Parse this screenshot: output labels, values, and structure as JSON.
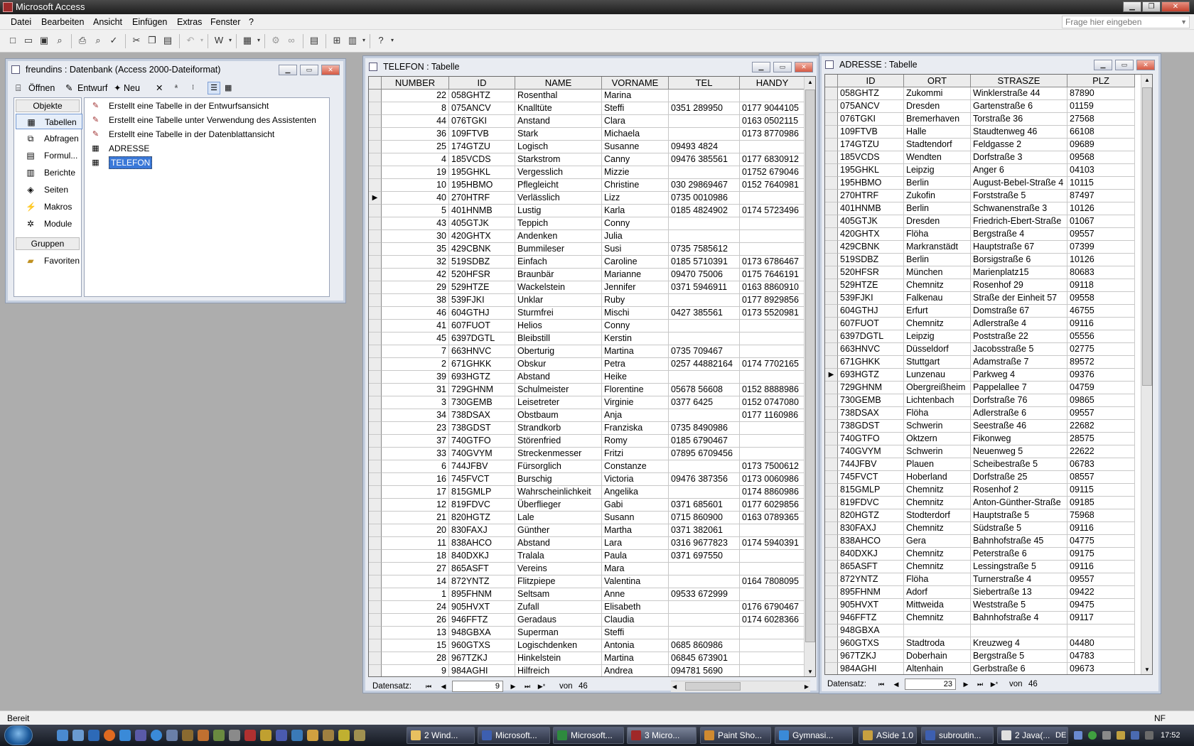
{
  "app": {
    "title": "Microsoft Access"
  },
  "menu": [
    "Datei",
    "Bearbeiten",
    "Ansicht",
    "Einfügen",
    "Extras",
    "Fenster",
    "?"
  ],
  "help_placeholder": "Frage hier eingeben",
  "toolbar_icons": [
    "new-icon",
    "open-icon",
    "save-icon",
    "search-icon",
    "print-icon",
    "print-preview-icon",
    "spellcheck-icon",
    "cut-icon",
    "copy-icon",
    "paste-icon",
    "undo-icon",
    "redo-icon",
    "office-links-icon",
    "analyze-icon",
    "code-icon",
    "properties-icon",
    "relationships-icon",
    "new-object-icon",
    "help-icon"
  ],
  "dbwindow": {
    "title": "freundins : Datenbank (Access 2000-Dateiformat)",
    "toolbar": {
      "open": "Öffnen",
      "design": "Entwurf",
      "new": "Neu"
    },
    "objects_header": "Objekte",
    "objects": [
      {
        "label": "Tabellen",
        "icon": "table-icon",
        "selected": true
      },
      {
        "label": "Abfragen",
        "icon": "query-icon"
      },
      {
        "label": "Formul...",
        "icon": "form-icon"
      },
      {
        "label": "Berichte",
        "icon": "report-icon"
      },
      {
        "label": "Seiten",
        "icon": "page-icon"
      },
      {
        "label": "Makros",
        "icon": "macro-icon"
      },
      {
        "label": "Module",
        "icon": "module-icon"
      }
    ],
    "groups_header": "Gruppen",
    "groups": [
      {
        "label": "Favoriten",
        "icon": "favorites-folder-icon"
      }
    ],
    "items": [
      {
        "label": "Erstellt eine Tabelle in der Entwurfsansicht",
        "icon": "wizard-icon"
      },
      {
        "label": "Erstellt eine Tabelle unter Verwendung des Assistenten",
        "icon": "wizard-icon"
      },
      {
        "label": "Erstellt eine Tabelle in der Datenblattansicht",
        "icon": "wizard-icon"
      },
      {
        "label": "ADRESSE",
        "icon": "table-icon"
      },
      {
        "label": "TELEFON",
        "icon": "table-icon",
        "selected": true
      }
    ]
  },
  "telefon": {
    "title": "TELEFON : Tabelle",
    "columns": [
      "NUMBER",
      "ID",
      "NAME",
      "VORNAME",
      "TEL",
      "HANDY"
    ],
    "current_row": 9,
    "rows": [
      [
        "22",
        "058GHTZ",
        "Rosenthal",
        "Marina",
        "",
        ""
      ],
      [
        "8",
        "075ANCV",
        "Knalltüte",
        "Steffi",
        "0351 289950",
        "0177 9044105"
      ],
      [
        "44",
        "076TGKI",
        "Anstand",
        "Clara",
        "",
        "0163 0502115"
      ],
      [
        "36",
        "109FTVB",
        "Stark",
        "Michaela",
        "",
        "0173 8770986"
      ],
      [
        "25",
        "174GTZU",
        "Logisch",
        "Susanne",
        "09493 4824",
        ""
      ],
      [
        "4",
        "185VCDS",
        "Starkstrom",
        "Canny",
        "09476 385561",
        "0177 6830912"
      ],
      [
        "19",
        "195GHKL",
        "Vergesslich",
        "Mizzie",
        "",
        "01752 679046"
      ],
      [
        "10",
        "195HBMO",
        "Pflegleicht",
        "Christine",
        "030 29869467",
        "0152 7640981"
      ],
      [
        "40",
        "270HTRF",
        "Verlässlich",
        "Lizz",
        "0735 0010986",
        ""
      ],
      [
        "5",
        "401HNMB",
        "Lustig",
        "Karla",
        "0185 4824902",
        "0174 5723496"
      ],
      [
        "43",
        "405GTJK",
        "Teppich",
        "Conny",
        "",
        ""
      ],
      [
        "30",
        "420GHTX",
        "Andenken",
        "Julia",
        "",
        ""
      ],
      [
        "35",
        "429CBNK",
        "Bummileser",
        "Susi",
        "0735 7585612",
        ""
      ],
      [
        "32",
        "519SDBZ",
        "Einfach",
        "Caroline",
        "0185 5710391",
        "0173 6786467"
      ],
      [
        "42",
        "520HFSR",
        "Braunbär",
        "Marianne",
        "09470 75006",
        "0175 7646191"
      ],
      [
        "29",
        "529HTZE",
        "Wackelstein",
        "Jennifer",
        "0371 5946911",
        "0163 8860910"
      ],
      [
        "38",
        "539FJKI",
        "Unklar",
        "Ruby",
        "",
        "0177 8929856"
      ],
      [
        "46",
        "604GTHJ",
        "Sturmfrei",
        "Mischi",
        "0427 385561",
        "0173 5520981"
      ],
      [
        "41",
        "607FUOT",
        "Helios",
        "Conny",
        "",
        ""
      ],
      [
        "45",
        "6397DGTL",
        "Bleibstill",
        "Kerstin",
        "",
        ""
      ],
      [
        "7",
        "663HNVC",
        "Oberturig",
        "Martina",
        "0735 709467",
        ""
      ],
      [
        "2",
        "671GHKK",
        "Obskur",
        "Petra",
        "0257 44882164",
        "0174 7702165"
      ],
      [
        "39",
        "693HGTZ",
        "Abstand",
        "Heike",
        "",
        ""
      ],
      [
        "31",
        "729GHNM",
        "Schulmeister",
        "Florentine",
        "05678 56608",
        "0152 8888986"
      ],
      [
        "3",
        "730GEMB",
        "Leisetreter",
        "Virginie",
        "0377 6425",
        "0152 0747080"
      ],
      [
        "34",
        "738DSAX",
        "Obstbaum",
        "Anja",
        "",
        "0177 1160986"
      ],
      [
        "23",
        "738GDST",
        "Strandkorb",
        "Franziska",
        "0735 8490986",
        ""
      ],
      [
        "37",
        "740GTFO",
        "Störenfried",
        "Romy",
        "0185 6790467",
        ""
      ],
      [
        "33",
        "740GVYM",
        "Streckenmesser",
        "Fritzi",
        "07895 6709456",
        ""
      ],
      [
        "6",
        "744JFBV",
        "Fürsorglich",
        "Constanze",
        "",
        "0173 7500612"
      ],
      [
        "16",
        "745FVCT",
        "Burschig",
        "Victoria",
        "09476 387356",
        "0173 0060986"
      ],
      [
        "17",
        "815GMLP",
        "Wahrscheinlichkeit",
        "Angelika",
        "",
        "0174 8860986"
      ],
      [
        "12",
        "819FDVC",
        "Überflieger",
        "Gabi",
        "0371 685601",
        "0177 6029856"
      ],
      [
        "21",
        "820HGTZ",
        "Lale",
        "Susann",
        "0715 860900",
        "0163 0789365"
      ],
      [
        "20",
        "830FAXJ",
        "Günther",
        "Martha",
        "0371 382061",
        ""
      ],
      [
        "11",
        "838AHCO",
        "Abstand",
        "Lara",
        "0316 9677823",
        "0174 5940391"
      ],
      [
        "18",
        "840DXKJ",
        "Tralala",
        "Paula",
        "0371 697550",
        ""
      ],
      [
        "27",
        "865ASFT",
        "Vereins",
        "Mara",
        "",
        ""
      ],
      [
        "14",
        "872YNTZ",
        "Flitzpiepe",
        "Valentina",
        "",
        "0164 7808095"
      ],
      [
        "1",
        "895FHNM",
        "Seltsam",
        "Anne",
        "09533 672999",
        ""
      ],
      [
        "24",
        "905HVXT",
        "Zufall",
        "Elisabeth",
        "",
        "0176 6790467"
      ],
      [
        "26",
        "946FFTZ",
        "Geradaus",
        "Claudia",
        "",
        "0174 6028366"
      ],
      [
        "13",
        "948GBXA",
        "Superman",
        "Steffi",
        "",
        ""
      ],
      [
        "15",
        "960GTXS",
        "Logischdenken",
        "Antonia",
        "0685 860986",
        ""
      ],
      [
        "28",
        "967TZKJ",
        "Hinkelstein",
        "Martina",
        "06845 673901",
        ""
      ],
      [
        "9",
        "984AGHI",
        "Hilfreich",
        "Andrea",
        "094781 5690",
        ""
      ]
    ],
    "nav": {
      "label": "Datensatz:",
      "current": "9",
      "of": "von",
      "total": "46"
    }
  },
  "adresse": {
    "title": "ADRESSE : Tabelle",
    "columns": [
      "ID",
      "ORT",
      "STRASZE",
      "PLZ"
    ],
    "current_row": 23,
    "rows": [
      [
        "058GHTZ",
        "Zukommi",
        "Winklerstraße 44",
        "87890"
      ],
      [
        "075ANCV",
        "Dresden",
        "Gartenstraße 6",
        "01159"
      ],
      [
        "076TGKI",
        "Bremerhaven",
        "Torstraße 36",
        "27568"
      ],
      [
        "109FTVB",
        "Halle",
        "Staudtenweg 46",
        "66108"
      ],
      [
        "174GTZU",
        "Stadtendorf",
        "Feldgasse 2",
        "09689"
      ],
      [
        "185VCDS",
        "Wendten",
        "Dorfstraße 3",
        "09568"
      ],
      [
        "195GHKL",
        "Leipzig",
        "Anger 6",
        "04103"
      ],
      [
        "195HBMO",
        "Berlin",
        "August-Bebel-Straße 4",
        "10115"
      ],
      [
        "270HTRF",
        "Zukofin",
        "Forststraße 5",
        "87497"
      ],
      [
        "401HNMB",
        "Berlin",
        "Schwanenstraße 3",
        "10126"
      ],
      [
        "405GTJK",
        "Dresden",
        "Friedrich-Ebert-Straße",
        "01067"
      ],
      [
        "420GHTX",
        "Flöha",
        "Bergstraße 4",
        "09557"
      ],
      [
        "429CBNK",
        "Markranstädt",
        "Hauptstraße 67",
        "07399"
      ],
      [
        "519SDBZ",
        "Berlin",
        "Borsigstraße 6",
        "10126"
      ],
      [
        "520HFSR",
        "München",
        "Marienplatz15",
        "80683"
      ],
      [
        "529HTZE",
        "Chemnitz",
        "Rosenhof 29",
        "09118"
      ],
      [
        "539FJKI",
        "Falkenau",
        "Straße der Einheit 57",
        "09558"
      ],
      [
        "604GTHJ",
        "Erfurt",
        "Domstraße 67",
        "46755"
      ],
      [
        "607FUOT",
        "Chemnitz",
        "Adlerstraße 4",
        "09116"
      ],
      [
        "6397DGTL",
        "Leipzig",
        "Poststraße 22",
        "05556"
      ],
      [
        "663HNVC",
        "Düsseldorf",
        "Jacobsstraße 5",
        "02775"
      ],
      [
        "671GHKK",
        "Stuttgart",
        "Adamstraße 7",
        "89572"
      ],
      [
        "693HGTZ",
        "Lunzenau",
        "Parkweg 4",
        "09376"
      ],
      [
        "729GHNM",
        "Obergreißheim",
        "Pappelallee 7",
        "04759"
      ],
      [
        "730GEMB",
        "Lichtenbach",
        "Dorfstraße 76",
        "09865"
      ],
      [
        "738DSAX",
        "Flöha",
        "Adlerstraße 6",
        "09557"
      ],
      [
        "738GDST",
        "Schwerin",
        "Seestraße 46",
        "22682"
      ],
      [
        "740GTFO",
        "Oktzern",
        "Fikonweg",
        "28575"
      ],
      [
        "740GVYM",
        "Schwerin",
        "Neuenweg 5",
        "22622"
      ],
      [
        "744JFBV",
        "Plauen",
        "Scheibestraße 5",
        "06783"
      ],
      [
        "745FVCT",
        "Hoberland",
        "Dorfstraße 25",
        "08557"
      ],
      [
        "815GMLP",
        "Chemnitz",
        "Rosenhof 2",
        "09115"
      ],
      [
        "819FDVC",
        "Chemnitz",
        "Anton-Günther-Straße",
        "09185"
      ],
      [
        "820HGTZ",
        "Stodterdorf",
        "Hauptstraße 5",
        "75968"
      ],
      [
        "830FAXJ",
        "Chemnitz",
        "Südstraße 5",
        "09116"
      ],
      [
        "838AHCO",
        "Gera",
        "Bahnhofstraße 45",
        "04775"
      ],
      [
        "840DXKJ",
        "Chemnitz",
        "Peterstraße 6",
        "09175"
      ],
      [
        "865ASFT",
        "Chemnitz",
        "Lessingstraße 5",
        "09116"
      ],
      [
        "872YNTZ",
        "Flöha",
        "Turnerstraße 4",
        "09557"
      ],
      [
        "895FHNM",
        "Adorf",
        "Siebertraße 13",
        "09422"
      ],
      [
        "905HVXT",
        "Mittweida",
        "Weststraße 5",
        "09475"
      ],
      [
        "946FFTZ",
        "Chemnitz",
        "Bahnhofstraße 4",
        "09117"
      ],
      [
        "948GBXA",
        "",
        "",
        ""
      ],
      [
        "960GTXS",
        "Stadtroda",
        "Kreuzweg 4",
        "04480"
      ],
      [
        "967TZKJ",
        "Doberhain",
        "Bergstraße 5",
        "04783"
      ],
      [
        "984AGHI",
        "Altenhain",
        "Gerbstraße 6",
        "09673"
      ]
    ],
    "nav": {
      "label": "Datensatz:",
      "current": "23",
      "of": "von",
      "total": "46"
    }
  },
  "status": {
    "left": "Bereit",
    "right": "NF"
  },
  "taskbar": {
    "items": [
      {
        "label": "2 Wind...",
        "icon": "folder-icon",
        "color": "#e8c060"
      },
      {
        "label": "Microsoft...",
        "icon": "word-icon",
        "color": "#3d5fb0"
      },
      {
        "label": "Microsoft...",
        "icon": "excel-icon",
        "color": "#2e8a3e"
      },
      {
        "label": "3 Micro...",
        "icon": "access-icon",
        "color": "#a02828",
        "active": true
      },
      {
        "label": "Paint Sho...",
        "icon": "paintshop-icon",
        "color": "#d08a30"
      },
      {
        "label": "Gymnasi...",
        "icon": "ie-icon",
        "color": "#3a8ad8"
      },
      {
        "label": "ASide 1.0",
        "icon": "aside-icon",
        "color": "#c8a040"
      },
      {
        "label": "subroutin...",
        "icon": "word-doc-icon",
        "color": "#3d5fb0"
      },
      {
        "label": "2 Java(...",
        "icon": "java-icon",
        "color": "#e0e0e0"
      }
    ],
    "tray": {
      "lang": "DE",
      "time": "17:52"
    }
  }
}
